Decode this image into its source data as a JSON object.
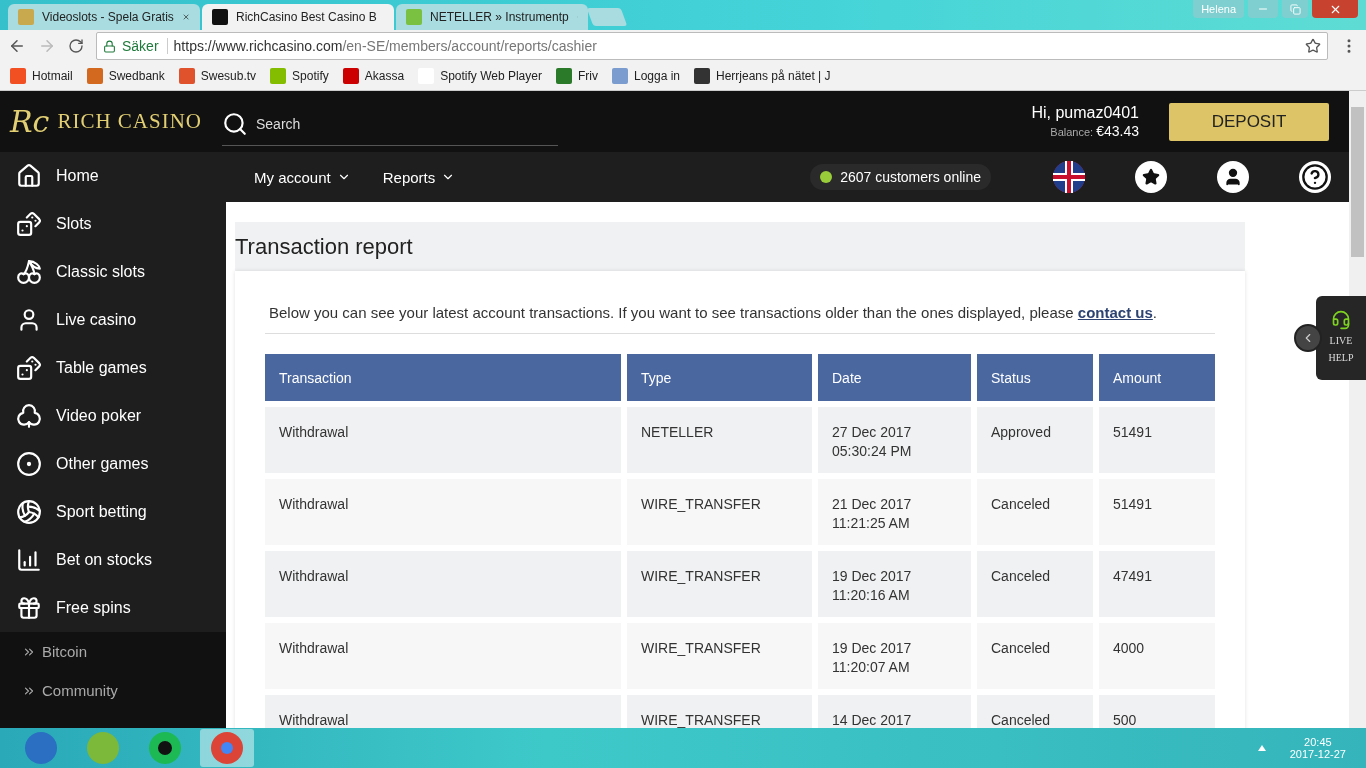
{
  "browser": {
    "tabs": [
      {
        "title": "Videoslots - Spela Gratis",
        "selected": false
      },
      {
        "title": "RichCasino Best Casino B",
        "selected": true
      },
      {
        "title": "NETELLER » Instrumentp",
        "selected": false
      }
    ],
    "profile": "Helena",
    "secure_label": "Säker",
    "url_host": "https://www.richcasino.com",
    "url_path": "/en-SE/members/account/reports/cashier",
    "bookmarks": [
      "Hotmail",
      "Swedbank",
      "Swesub.tv",
      "Spotify",
      "Akassa",
      "Spotify Web Player",
      "Friv",
      "Logga in",
      "Herrjeans på nätet | J"
    ]
  },
  "site": {
    "logo_monogram": "Rc",
    "logo_text": "RICH CASINO",
    "search_placeholder": "Search",
    "greeting": "Hi, pumaz0401",
    "balance_label": "Balance:",
    "balance_value": "€43.43",
    "deposit": "DEPOSIT",
    "nav": [
      {
        "label": "My account"
      },
      {
        "label": "Reports"
      }
    ],
    "online": "2607 customers online",
    "sidebar": [
      {
        "label": "Home",
        "kind": "main"
      },
      {
        "label": "Slots",
        "kind": "main"
      },
      {
        "label": "Classic slots",
        "kind": "main"
      },
      {
        "label": "Live casino",
        "kind": "main"
      },
      {
        "label": "Table games",
        "kind": "main"
      },
      {
        "label": "Video poker",
        "kind": "main"
      },
      {
        "label": "Other games",
        "kind": "main"
      },
      {
        "label": "Sport betting",
        "kind": "main"
      },
      {
        "label": "Bet on stocks",
        "kind": "main"
      },
      {
        "label": "Free spins",
        "kind": "main"
      },
      {
        "label": "Bitcoin",
        "kind": "sub"
      },
      {
        "label": "Community",
        "kind": "sub"
      }
    ],
    "live_help": [
      "LIVE",
      "HELP"
    ]
  },
  "report": {
    "title": "Transaction report",
    "intro": "Below you can see your latest account transactions. If you want to see transactions older than the ones displayed, please ",
    "link": "contact us",
    "intro_end": ".",
    "columns": [
      "Transaction",
      "Type",
      "Date",
      "Status",
      "Amount"
    ],
    "rows": [
      [
        "Withdrawal",
        "NETELLER",
        "27 Dec 2017\n05:30:24 PM",
        "Approved",
        "51491"
      ],
      [
        "Withdrawal",
        "WIRE_TRANSFER",
        "21 Dec 2017\n11:21:25 AM",
        "Canceled",
        "51491"
      ],
      [
        "Withdrawal",
        "WIRE_TRANSFER",
        "19 Dec 2017\n11:20:16 AM",
        "Canceled",
        "47491"
      ],
      [
        "Withdrawal",
        "WIRE_TRANSFER",
        "19 Dec 2017\n11:20:07 AM",
        "Canceled",
        "4000"
      ],
      [
        "Withdrawal",
        "WIRE_TRANSFER",
        "14 Dec 2017",
        "Canceled",
        "500"
      ]
    ]
  },
  "taskbar": {
    "apps": [
      {
        "selected": false
      },
      {
        "selected": false
      },
      {
        "selected": false
      },
      {
        "selected": true
      }
    ],
    "time": "20:45",
    "date": "2017-12-27"
  }
}
